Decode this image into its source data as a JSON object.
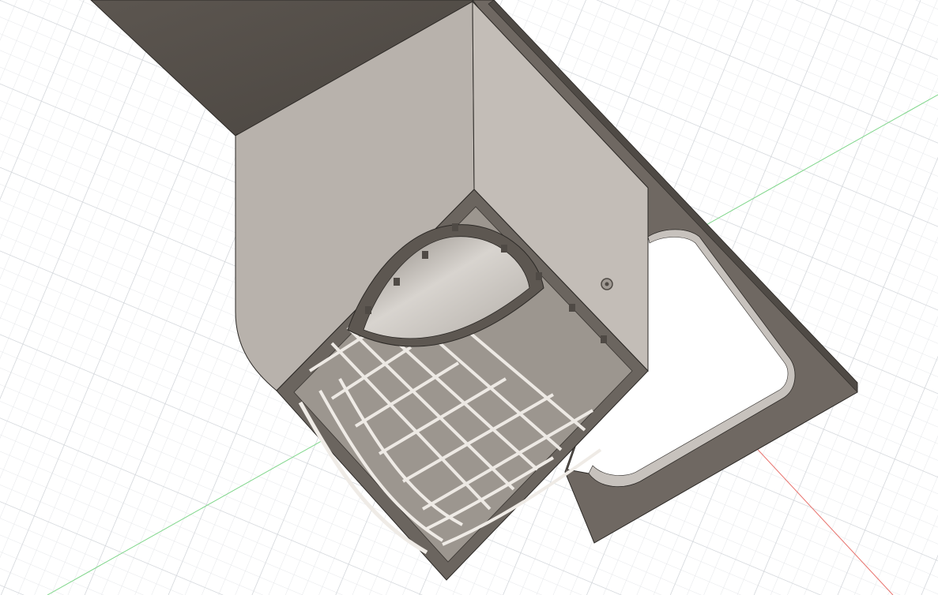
{
  "viewport": {
    "background": "#ffffff",
    "grid_minor_color": "#e3e5e8",
    "grid_major_color": "#ccd0d5",
    "axis_x_color": "#e8726d",
    "axis_y_color": "#7fd68a",
    "origin_marker": "origin-point-icon"
  },
  "model": {
    "material_light": "#c7c2bd",
    "material_mid": "#a9a39d",
    "material_dark": "#6f6862",
    "material_shadow": "#4f4a45",
    "edge_color": "#2d2a27",
    "parts": [
      "mounting-arm",
      "square-housing",
      "honeycomb-grill",
      "dome-cavity",
      "base-bracket"
    ]
  }
}
